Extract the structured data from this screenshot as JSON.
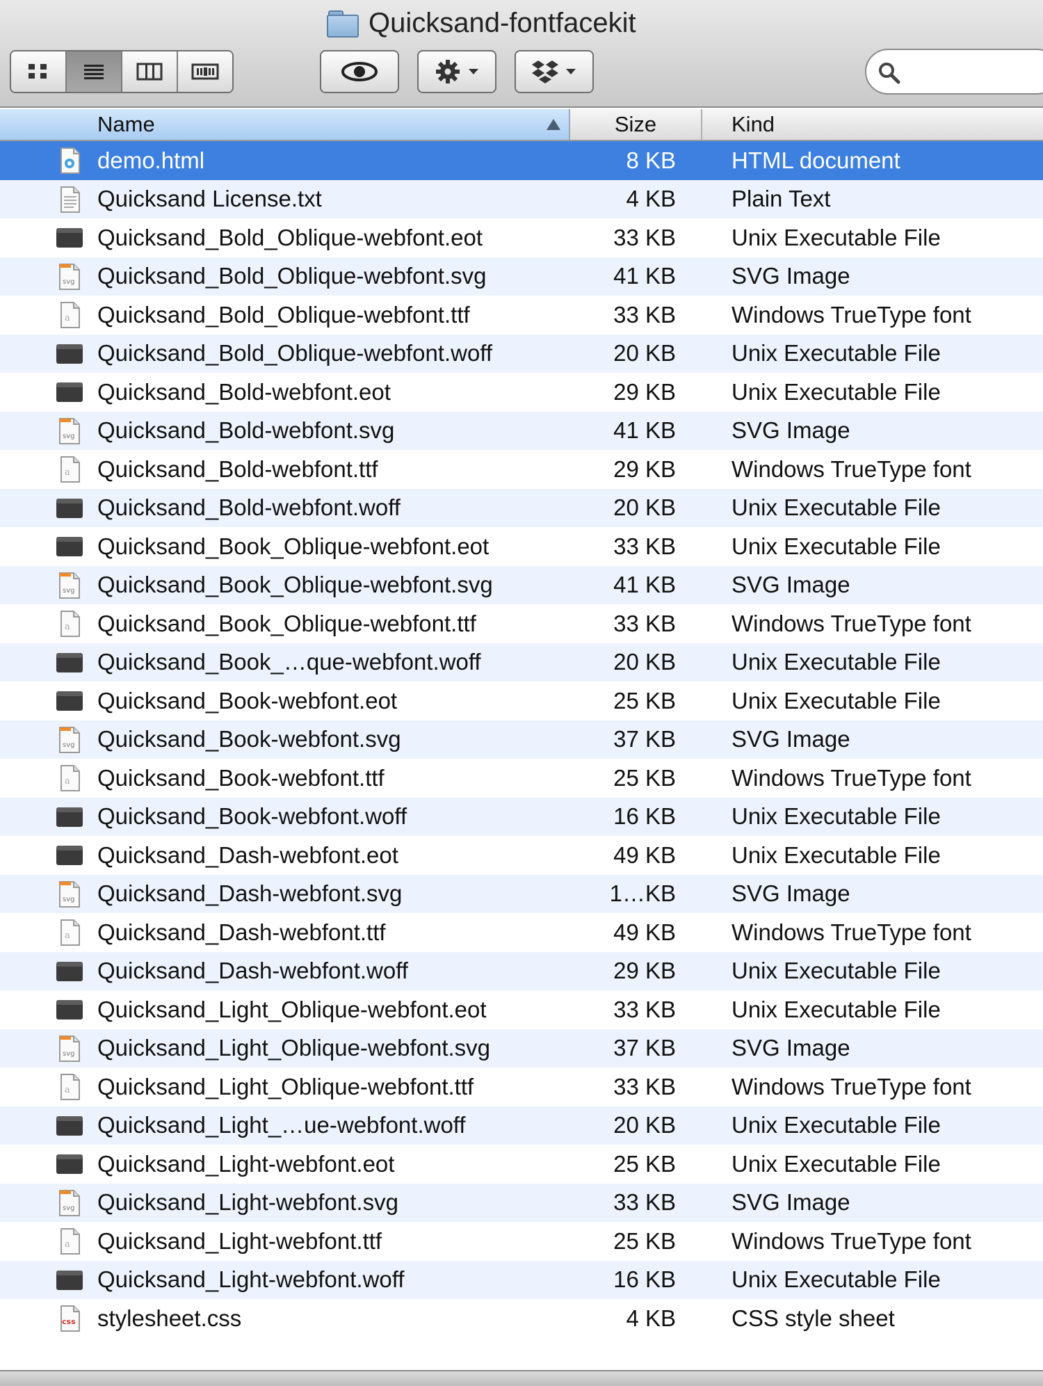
{
  "window": {
    "title": "Quicksand-fontfacekit",
    "title_icon": "folder-icon"
  },
  "toolbar": {
    "view_modes": [
      "icon-view-icon",
      "list-view-icon",
      "column-view-icon",
      "cover-flow-icon"
    ],
    "active_view": "list-view-icon",
    "quick_look_icon": "eye-icon",
    "action_icon": "gear-icon",
    "dropbox_icon": "dropbox-icon",
    "search": {
      "placeholder": "",
      "value": ""
    }
  },
  "columns": {
    "name": "Name",
    "size": "Size",
    "kind": "Kind",
    "sorted_by": "Name",
    "sort_direction": "ascending"
  },
  "colors": {
    "selection": "#3d80df",
    "alt_row": "#edf3fe",
    "header_active": "#a9cdf3"
  },
  "files": [
    {
      "name": "demo.html",
      "size": "8 KB",
      "kind": "HTML document",
      "icon": "html",
      "selected": true
    },
    {
      "name": "Quicksand License.txt",
      "size": "4 KB",
      "kind": "Plain Text",
      "icon": "text"
    },
    {
      "name": "Quicksand_Bold_Oblique-webfont.eot",
      "size": "33 KB",
      "kind": "Unix Executable File",
      "icon": "exec"
    },
    {
      "name": "Quicksand_Bold_Oblique-webfont.svg",
      "size": "41 KB",
      "kind": "SVG Image",
      "icon": "svg"
    },
    {
      "name": "Quicksand_Bold_Oblique-webfont.ttf",
      "size": "33 KB",
      "kind": "Windows TrueType font",
      "icon": "font"
    },
    {
      "name": "Quicksand_Bold_Oblique-webfont.woff",
      "size": "20 KB",
      "kind": "Unix Executable File",
      "icon": "exec"
    },
    {
      "name": "Quicksand_Bold-webfont.eot",
      "size": "29 KB",
      "kind": "Unix Executable File",
      "icon": "exec"
    },
    {
      "name": "Quicksand_Bold-webfont.svg",
      "size": "41 KB",
      "kind": "SVG Image",
      "icon": "svg"
    },
    {
      "name": "Quicksand_Bold-webfont.ttf",
      "size": "29 KB",
      "kind": "Windows TrueType font",
      "icon": "font"
    },
    {
      "name": "Quicksand_Bold-webfont.woff",
      "size": "20 KB",
      "kind": "Unix Executable File",
      "icon": "exec"
    },
    {
      "name": "Quicksand_Book_Oblique-webfont.eot",
      "size": "33 KB",
      "kind": "Unix Executable File",
      "icon": "exec"
    },
    {
      "name": "Quicksand_Book_Oblique-webfont.svg",
      "size": "41 KB",
      "kind": "SVG Image",
      "icon": "svg"
    },
    {
      "name": "Quicksand_Book_Oblique-webfont.ttf",
      "size": "33 KB",
      "kind": "Windows TrueType font",
      "icon": "font"
    },
    {
      "name": "Quicksand_Book_…que-webfont.woff",
      "size": "20 KB",
      "kind": "Unix Executable File",
      "icon": "exec"
    },
    {
      "name": "Quicksand_Book-webfont.eot",
      "size": "25 KB",
      "kind": "Unix Executable File",
      "icon": "exec"
    },
    {
      "name": "Quicksand_Book-webfont.svg",
      "size": "37 KB",
      "kind": "SVG Image",
      "icon": "svg"
    },
    {
      "name": "Quicksand_Book-webfont.ttf",
      "size": "25 KB",
      "kind": "Windows TrueType font",
      "icon": "font"
    },
    {
      "name": "Quicksand_Book-webfont.woff",
      "size": "16 KB",
      "kind": "Unix Executable File",
      "icon": "exec"
    },
    {
      "name": "Quicksand_Dash-webfont.eot",
      "size": "49 KB",
      "kind": "Unix Executable File",
      "icon": "exec"
    },
    {
      "name": "Quicksand_Dash-webfont.svg",
      "size": "1…KB",
      "kind": "SVG Image",
      "icon": "svg"
    },
    {
      "name": "Quicksand_Dash-webfont.ttf",
      "size": "49 KB",
      "kind": "Windows TrueType font",
      "icon": "font"
    },
    {
      "name": "Quicksand_Dash-webfont.woff",
      "size": "29 KB",
      "kind": "Unix Executable File",
      "icon": "exec"
    },
    {
      "name": "Quicksand_Light_Oblique-webfont.eot",
      "size": "33 KB",
      "kind": "Unix Executable File",
      "icon": "exec"
    },
    {
      "name": "Quicksand_Light_Oblique-webfont.svg",
      "size": "37 KB",
      "kind": "SVG Image",
      "icon": "svg"
    },
    {
      "name": "Quicksand_Light_Oblique-webfont.ttf",
      "size": "33 KB",
      "kind": "Windows TrueType font",
      "icon": "font"
    },
    {
      "name": "Quicksand_Light_…ue-webfont.woff",
      "size": "20 KB",
      "kind": "Unix Executable File",
      "icon": "exec"
    },
    {
      "name": "Quicksand_Light-webfont.eot",
      "size": "25 KB",
      "kind": "Unix Executable File",
      "icon": "exec"
    },
    {
      "name": "Quicksand_Light-webfont.svg",
      "size": "33 KB",
      "kind": "SVG Image",
      "icon": "svg"
    },
    {
      "name": "Quicksand_Light-webfont.ttf",
      "size": "25 KB",
      "kind": "Windows TrueType font",
      "icon": "font"
    },
    {
      "name": "Quicksand_Light-webfont.woff",
      "size": "16 KB",
      "kind": "Unix Executable File",
      "icon": "exec"
    },
    {
      "name": "stylesheet.css",
      "size": "4 KB",
      "kind": "CSS style sheet",
      "icon": "css"
    }
  ]
}
